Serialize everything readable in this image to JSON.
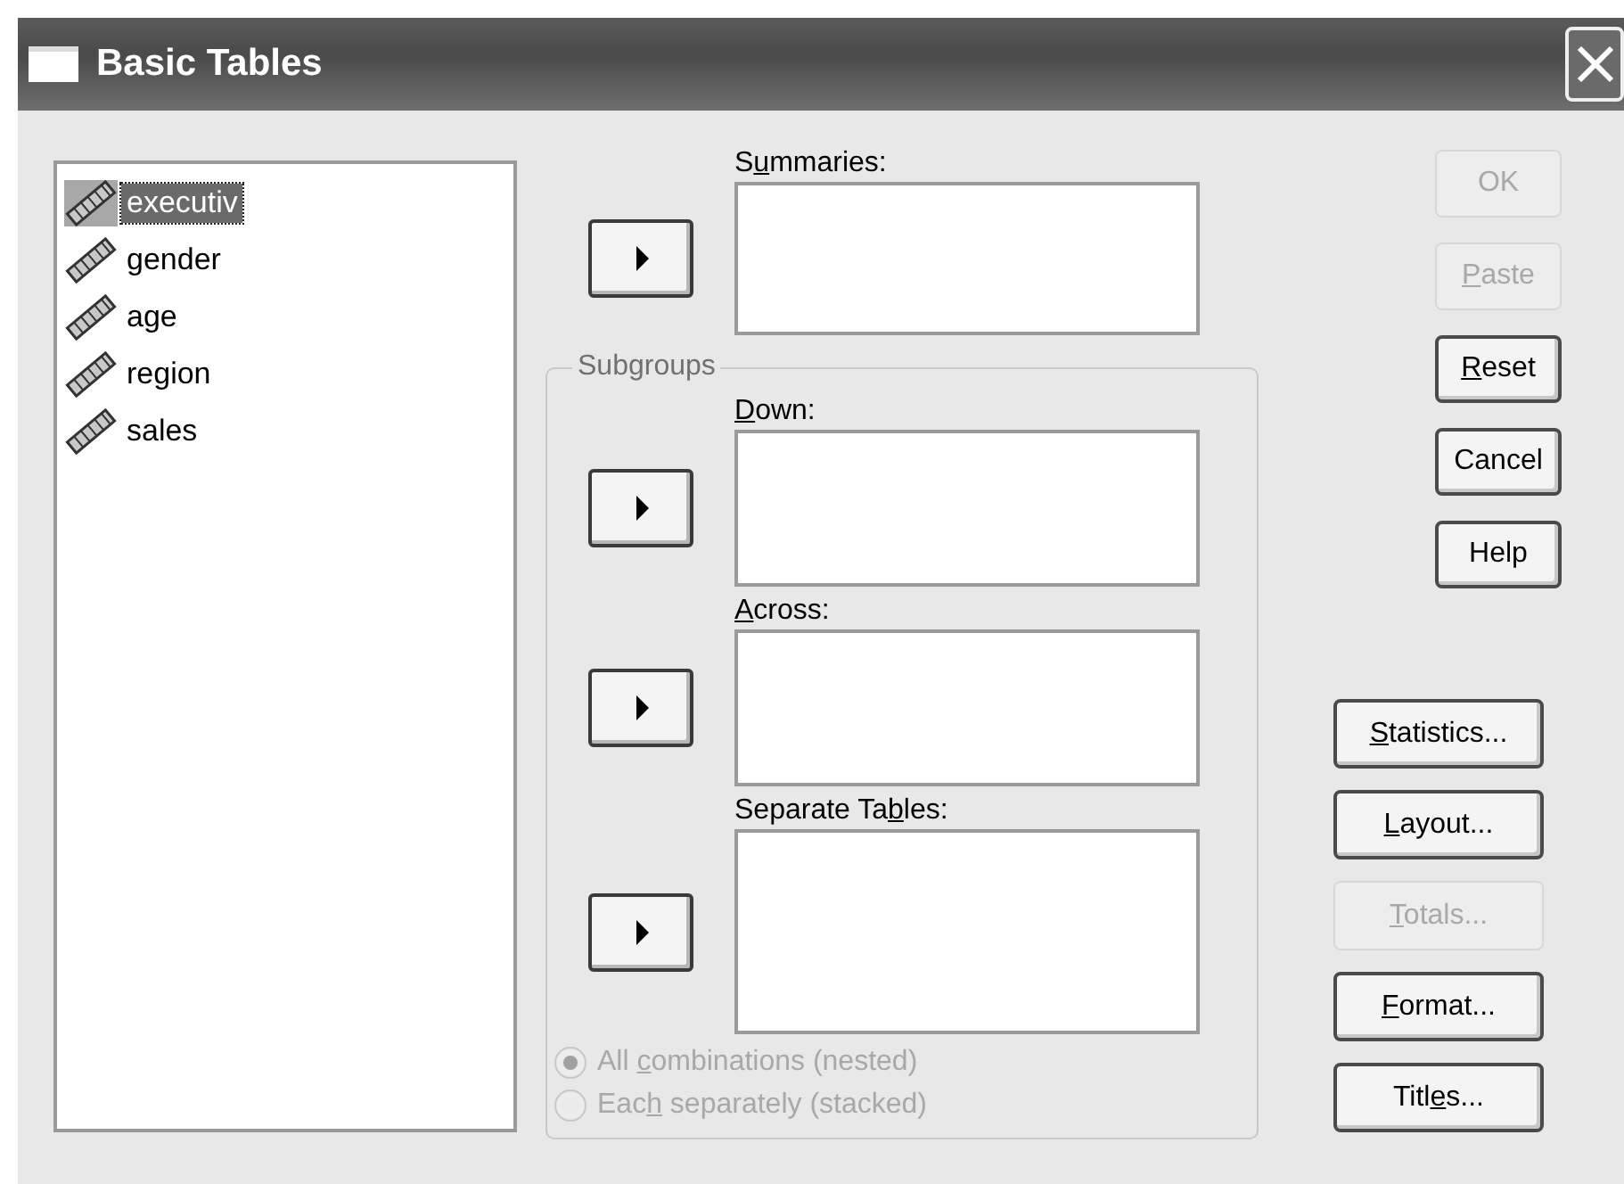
{
  "window": {
    "title": "Basic Tables"
  },
  "variables": [
    {
      "name": "executiv",
      "selected": true
    },
    {
      "name": "gender",
      "selected": false
    },
    {
      "name": "age",
      "selected": false
    },
    {
      "name": "region",
      "selected": false
    },
    {
      "name": "sales",
      "selected": false
    }
  ],
  "summaries": {
    "label_before": "S",
    "access_key": "u",
    "label_after": "mmaries:"
  },
  "subgroups": {
    "title": "Subgroups",
    "targets": [
      {
        "access_key": "D",
        "label_after": "own:"
      },
      {
        "access_key": "A",
        "label_after": "cross:"
      },
      {
        "label_before": "Separate Ta",
        "access_key": "b",
        "label_after": "les:"
      }
    ],
    "options": [
      {
        "label_before": "All ",
        "access_key": "c",
        "label_after": "ombinations (nested)",
        "selected": true,
        "disabled": true
      },
      {
        "label_before": "Eac",
        "access_key": "h",
        "label_after": " separately (stacked)",
        "selected": false,
        "disabled": true
      }
    ]
  },
  "buttons": [
    {
      "label": "OK",
      "disabled": true
    },
    {
      "access_key": "P",
      "label_after": "aste",
      "disabled": true
    },
    {
      "access_key": "R",
      "label_after": "eset",
      "disabled": false
    },
    {
      "label": "Cancel",
      "disabled": false
    },
    {
      "label": "Help",
      "disabled": false
    }
  ],
  "option_buttons": [
    {
      "access_key": "S",
      "label_after": "tatistics...",
      "disabled": false
    },
    {
      "access_key": "L",
      "label_after": "ayout...",
      "disabled": false
    },
    {
      "access_key": "T",
      "label_after": "otals...",
      "disabled": true
    },
    {
      "access_key": "F",
      "label_after": "ormat...",
      "disabled": false
    },
    {
      "label_before": "Titl",
      "access_key": "e",
      "label_after": "s...",
      "disabled": false
    }
  ]
}
